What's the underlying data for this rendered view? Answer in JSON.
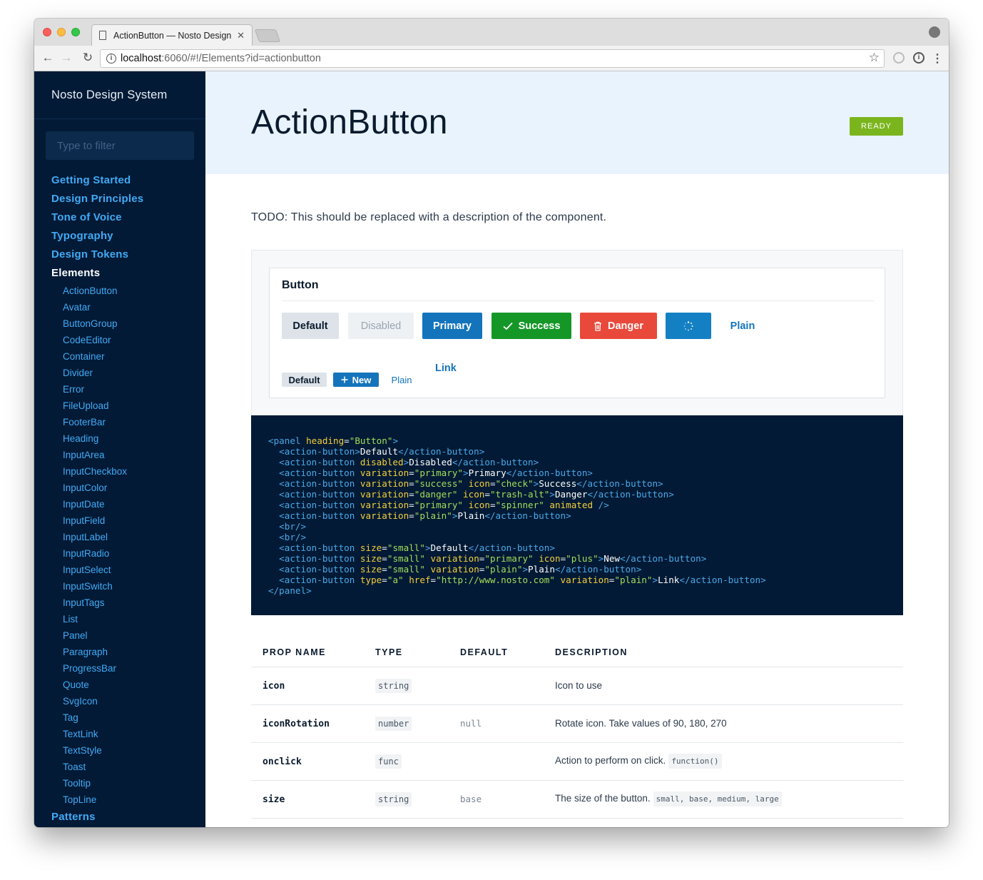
{
  "browser": {
    "tab_title": "ActionButton — Nosto Design",
    "url_host": "localhost",
    "url_rest": ":6060/#!/Elements?id=actionbutton"
  },
  "sidebar": {
    "brand": "Nosto Design System",
    "filter_placeholder": "Type to filter",
    "sections": [
      "Getting Started",
      "Design Principles",
      "Tone of Voice",
      "Typography",
      "Design Tokens",
      "Elements"
    ],
    "elements": [
      "ActionButton",
      "Avatar",
      "ButtonGroup",
      "CodeEditor",
      "Container",
      "Divider",
      "Error",
      "FileUpload",
      "FooterBar",
      "Heading",
      "InputArea",
      "InputCheckbox",
      "InputColor",
      "InputDate",
      "InputField",
      "InputLabel",
      "InputRadio",
      "InputSelect",
      "InputSwitch",
      "InputTags",
      "List",
      "Panel",
      "Paragraph",
      "ProgressBar",
      "Quote",
      "SvgIcon",
      "Tag",
      "TextLink",
      "TextStyle",
      "Toast",
      "Tooltip",
      "TopLine"
    ],
    "patterns": "Patterns"
  },
  "page": {
    "title": "ActionButton",
    "status": "READY",
    "description": "TODO: This should be replaced with a description of the component."
  },
  "demo": {
    "panel_heading": "Button",
    "buttons": {
      "default": "Default",
      "disabled": "Disabled",
      "primary": "Primary",
      "success": "Success",
      "danger": "Danger",
      "plain": "Plain",
      "small_default": "Default",
      "small_new": "New",
      "small_plain": "Plain",
      "link": "Link"
    }
  },
  "props_table": {
    "headers": [
      "PROP NAME",
      "TYPE",
      "DEFAULT",
      "DESCRIPTION"
    ],
    "rows": [
      {
        "name": "icon",
        "type": "string",
        "default": "",
        "description": "Icon to use",
        "chip": ""
      },
      {
        "name": "iconRotation",
        "type": "number",
        "default": "null",
        "description": "Rotate icon. Take values of 90, 180, 270",
        "chip": ""
      },
      {
        "name": "onclick",
        "type": "func",
        "default": "",
        "description": "Action to perform on click.",
        "chip": "function()"
      },
      {
        "name": "size",
        "type": "string",
        "default": "base",
        "description": "The size of the button.",
        "chip": "small, base, medium, large"
      }
    ]
  },
  "colors": {
    "sidebar_bg": "#021a35",
    "link": "#41a9f5",
    "primary": "#1474bb",
    "success": "#159728",
    "danger": "#e9493b",
    "ready": "#7bb51d"
  }
}
